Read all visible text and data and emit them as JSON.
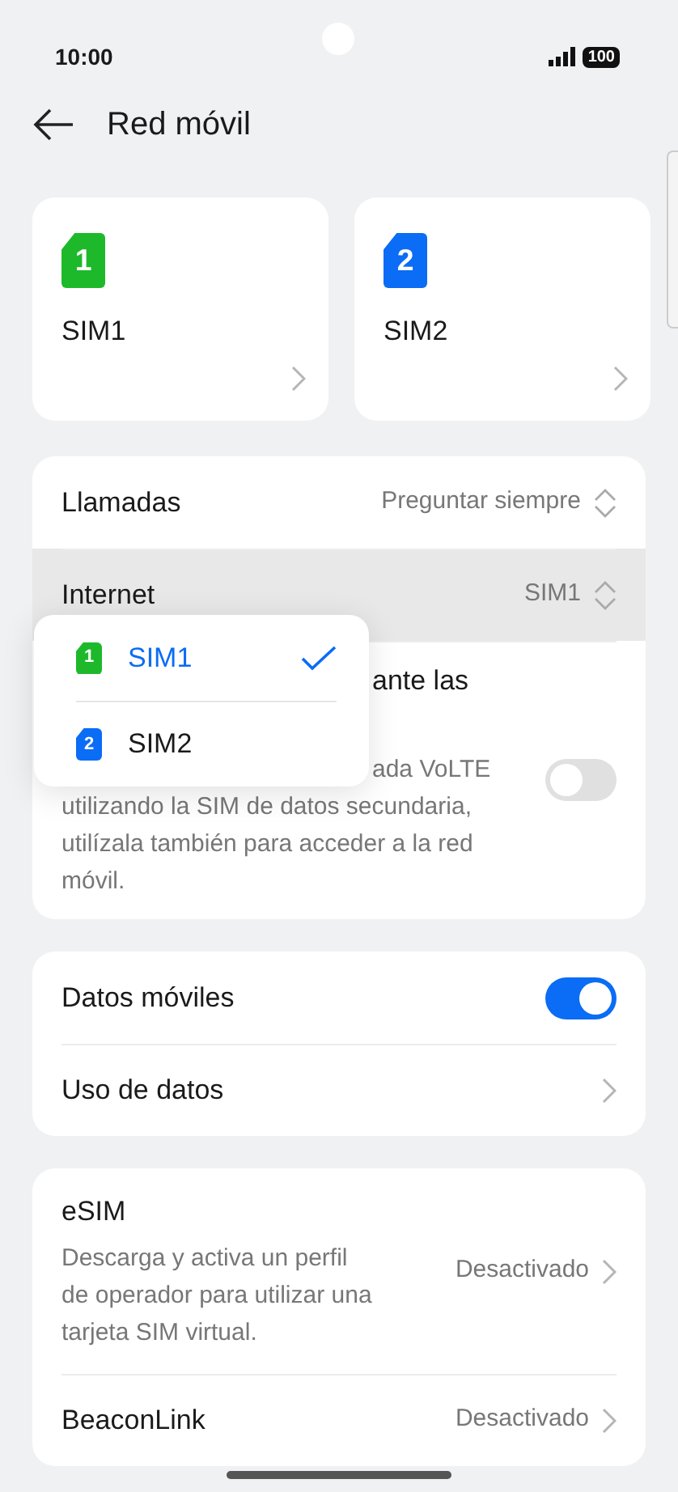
{
  "status_bar": {
    "time": "10:00",
    "battery": "100"
  },
  "header": {
    "title": "Red móvil"
  },
  "sim_cards": [
    {
      "badge": "1",
      "label": "SIM1",
      "color": "#1db92b"
    },
    {
      "badge": "2",
      "label": "SIM2",
      "color": "#0b6cf5"
    }
  ],
  "sim_settings": [
    {
      "kind": "select",
      "label": "Llamadas",
      "value": "Preguntar siempre",
      "highlighted": false
    },
    {
      "kind": "select",
      "label": "Internet",
      "value": "SIM1",
      "highlighted": true
    },
    {
      "kind": "toggle",
      "label": "ante las",
      "description": "ada VoLTE\nutilizando la SIM de datos secundaria,\nutilízala también para acceder a la red\nmóvil.",
      "on": false
    }
  ],
  "popup_menu": [
    {
      "badge": "1",
      "label": "SIM1",
      "color": "#1db92b",
      "selected": true
    },
    {
      "badge": "2",
      "label": "SIM2",
      "color": "#0b6cf5",
      "selected": false
    }
  ],
  "data_settings": [
    {
      "kind": "toggle",
      "label": "Datos móviles",
      "on": true
    },
    {
      "kind": "link",
      "label": "Uso de datos"
    }
  ],
  "other_settings": [
    {
      "kind": "link",
      "label": "eSIM",
      "description": "Descarga y activa un perfil\nde operador para utilizar una\ntarjeta SIM virtual.",
      "value": "Desactivado"
    },
    {
      "kind": "link",
      "label": "BeaconLink",
      "value": "Desactivado"
    }
  ]
}
